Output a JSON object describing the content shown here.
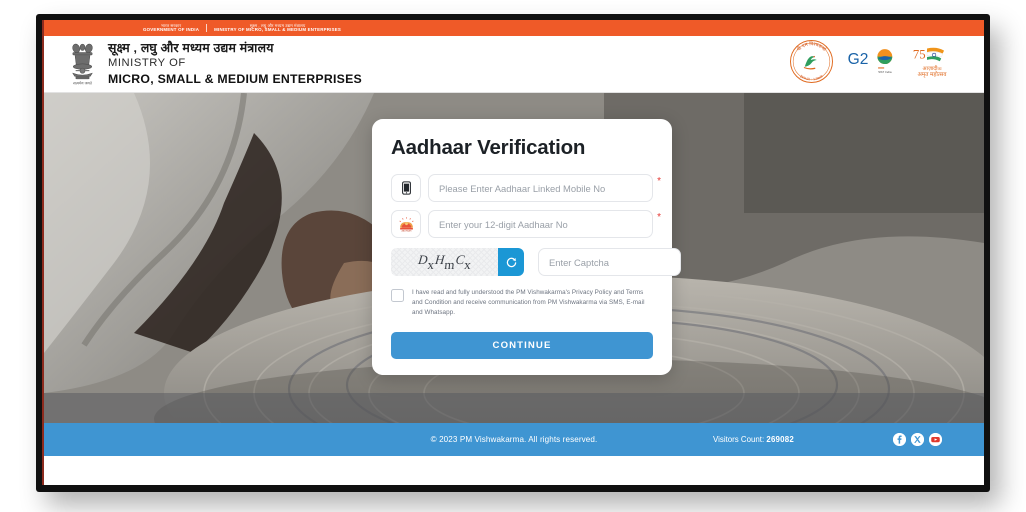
{
  "gov_strip": {
    "left_hindi": "भारत सरकार",
    "left_english": "GOVERNMENT OF INDIA",
    "right_hindi": "सूक्ष्म , लघु और मध्यम उद्यम मंत्रालय",
    "right_english": "MINISTRY OF MICRO, SMALL & MEDIUM ENTERPRISES"
  },
  "header": {
    "ministry_hindi": "सूक्ष्म , लघु और मध्यम उद्यम मंत्रालय",
    "ministry_of": "MINISTRY OF",
    "ministry_name": "MICRO, SMALL & MEDIUM ENTERPRISES",
    "emblem_name": "state-emblem-of-india",
    "emblem_motto": "सत्यमेव जयते",
    "logos": [
      {
        "name": "pm-vishwakarma-logo",
        "label": "PM Vishwakarma"
      },
      {
        "name": "g20-logo",
        "label": "G20"
      },
      {
        "name": "azadi-ka-amrit-mahotsav-logo",
        "label": "आज़ादी का अमृत महोत्सव"
      }
    ]
  },
  "card": {
    "title": "Aadhaar Verification",
    "mobile_field": {
      "placeholder": "Please Enter Aadhaar Linked Mobile No",
      "value": "",
      "icon": "mobile-phone-icon",
      "required_marker": "*"
    },
    "aadhaar_field": {
      "placeholder": "Enter your 12-digit Aadhaar No",
      "value": "",
      "icon": "aadhaar-logo-icon",
      "required_marker": "*"
    },
    "captcha": {
      "code": "DxHmCx",
      "characters": [
        "D",
        "x",
        "H",
        "m",
        "C",
        "x"
      ],
      "refresh_icon": "refresh-icon",
      "input_placeholder": "Enter Captcha",
      "input_value": ""
    },
    "consent": {
      "checked": false,
      "text": "I have read and fully understood the PM Vishwakarma's Privacy Policy and Terms and Condition and receive communication from PM Vishwakarma via SMS, E-mail and Whatsapp."
    },
    "continue_label": "CONTINUE"
  },
  "footer": {
    "copyright": "© 2023 PM Vishwakarma. All rights reserved.",
    "visitors_label": "Visitors Count:",
    "visitors_count": "269082",
    "social": [
      {
        "name": "facebook-icon",
        "glyph": "f"
      },
      {
        "name": "x-twitter-icon",
        "glyph": "𝕏"
      },
      {
        "name": "youtube-icon",
        "glyph": "▶"
      }
    ]
  },
  "colors": {
    "gov_orange": "#ef5a28",
    "primary_blue": "#3f95d2",
    "captcha_blue": "#1b97d5",
    "required_red": "#e53935"
  }
}
